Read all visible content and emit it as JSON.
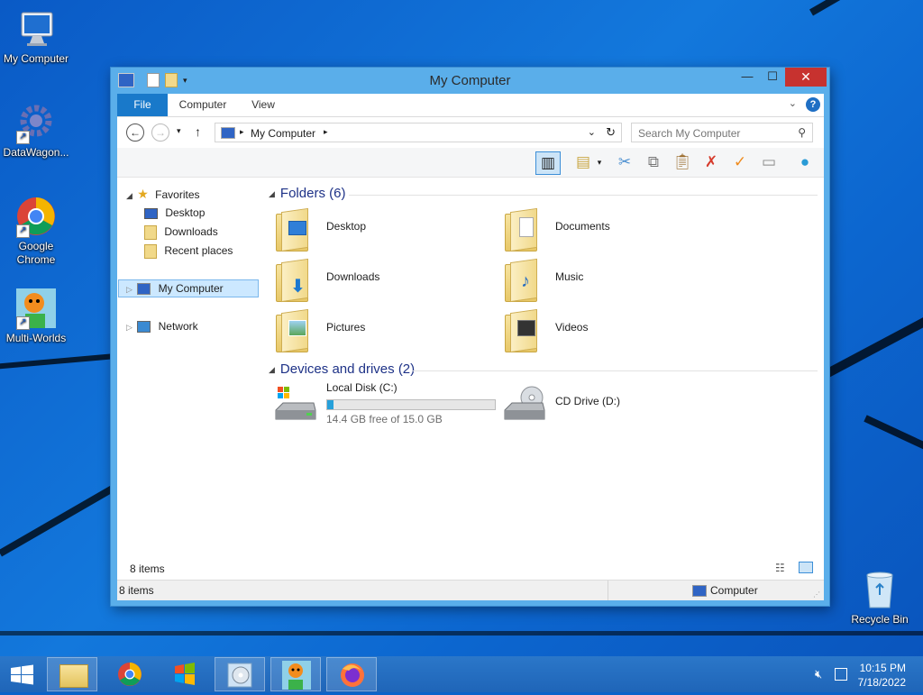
{
  "desktop": {
    "icons": [
      {
        "label": "My Computer",
        "icon": "monitor-icon",
        "shortcut": false
      },
      {
        "label": "DataWagon...",
        "icon": "gear-icon",
        "shortcut": true
      },
      {
        "label": "Google Chrome",
        "icon": "chrome-icon",
        "shortcut": true
      },
      {
        "label": "Multi-Worlds",
        "icon": "smiley-icon",
        "shortcut": true
      },
      {
        "label": "Recycle Bin",
        "icon": "recycle-bin-icon",
        "shortcut": false
      }
    ]
  },
  "window": {
    "title": "My Computer",
    "controls": {
      "minimize": "—",
      "maximize": "☐",
      "close": "✕"
    },
    "ribbon": {
      "tabs": [
        "File",
        "Computer",
        "View"
      ],
      "help": "?"
    },
    "address": {
      "path": "My Computer"
    },
    "search": {
      "placeholder": "Search My Computer"
    },
    "nav": {
      "favorites": "Favorites",
      "favorite_items": [
        "Desktop",
        "Downloads",
        "Recent places"
      ],
      "my_computer": "My Computer",
      "network": "Network"
    },
    "groups": {
      "folders": "Folders (6)",
      "devices": "Devices and drives (2)"
    },
    "folders": [
      "Desktop",
      "Documents",
      "Downloads",
      "Music",
      "Pictures",
      "Videos"
    ],
    "drives": [
      {
        "name": "Local Disk (C:)",
        "free_text": "14.4 GB free of 15.0 GB",
        "used_fraction": 0.04
      },
      {
        "name": "CD Drive (D:)"
      }
    ],
    "inner_status": "8 items",
    "status": {
      "left": "8 items",
      "right": "Computer"
    }
  },
  "taskbar": {
    "time": "10:15 PM",
    "date": "7/18/2022"
  },
  "colors": {
    "accent": "#1979ca",
    "close": "#c7322f",
    "progress": "#26a0da"
  }
}
